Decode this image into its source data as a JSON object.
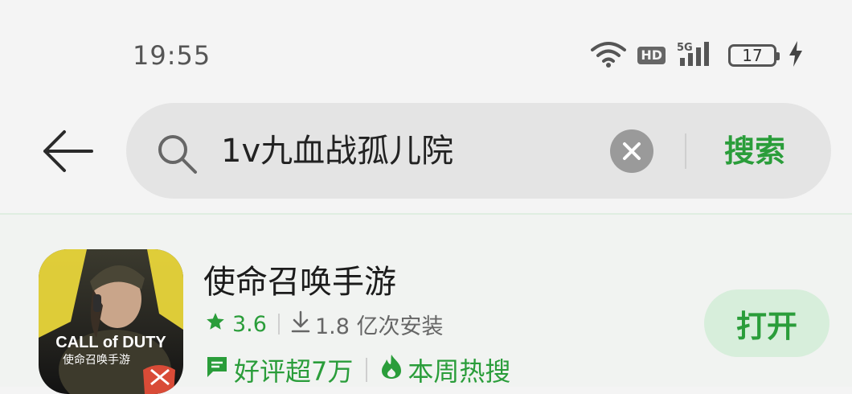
{
  "status_bar": {
    "time": "19:55",
    "hd_label": "HD",
    "network_label": "5G",
    "battery_level": "17",
    "icons": [
      "wifi-icon",
      "hd-icon",
      "signal-5g-icon",
      "battery-icon",
      "charging-icon"
    ]
  },
  "search": {
    "query": "1v九血战孤儿院",
    "search_button_label": "搜索"
  },
  "result": {
    "app_name": "使命召唤手游",
    "rating": "3.6",
    "installs": "1.8 亿次安装",
    "tags": [
      "好评超7万",
      "本周热搜"
    ],
    "open_button_label": "打开",
    "icon_text": {
      "logo": "CALL of DUTY",
      "subtitle": "使命召唤手游"
    }
  },
  "colors": {
    "accent_green": "#2a9d3a",
    "open_button_bg": "#d7eedb",
    "search_bar_bg": "#e4e4e4"
  }
}
